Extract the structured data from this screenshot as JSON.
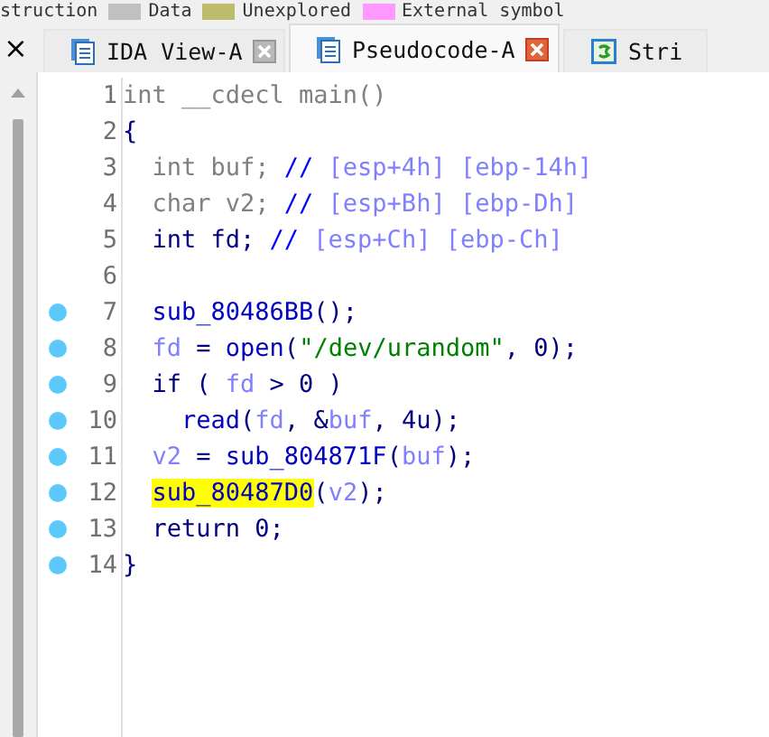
{
  "legend": [
    {
      "label": "struction"
    },
    {
      "label": "Data",
      "color": "#c0c0c0"
    },
    {
      "label": "Unexplored",
      "color": "#bcbc6c"
    },
    {
      "label": "External symbol",
      "color": "#ff99ff"
    }
  ],
  "side_close": "×",
  "tabs": [
    {
      "label": "IDA View-A",
      "selected": false,
      "kind": "view",
      "closable": true
    },
    {
      "label": "Pseudocode-A",
      "selected": true,
      "kind": "view",
      "closable": true
    },
    {
      "label": "Stri",
      "selected": false,
      "kind": "strings",
      "closable": false
    }
  ],
  "code_lines": [
    {
      "number": "1",
      "breakpoint": false,
      "tokens": [
        {
          "text": "int __cdecl main()",
          "kind": "type"
        }
      ]
    },
    {
      "number": "2",
      "breakpoint": false,
      "tokens": [
        {
          "text": "{",
          "kind": "plain"
        }
      ]
    },
    {
      "number": "3",
      "breakpoint": false,
      "tokens": [
        {
          "text": "  int buf; ",
          "kind": "type"
        },
        {
          "text": "// ",
          "kind": "comment"
        },
        {
          "text": "[esp+4h] [ebp-14h]",
          "kind": "var"
        }
      ]
    },
    {
      "number": "4",
      "breakpoint": false,
      "tokens": [
        {
          "text": "  char v2; ",
          "kind": "type"
        },
        {
          "text": "// ",
          "kind": "comment"
        },
        {
          "text": "[esp+Bh] [ebp-Dh]",
          "kind": "var"
        }
      ]
    },
    {
      "number": "5",
      "breakpoint": false,
      "tokens": [
        {
          "text": "  int fd; ",
          "kind": "plain"
        },
        {
          "text": "// ",
          "kind": "comment"
        },
        {
          "text": "[esp+Ch] [ebp-Ch]",
          "kind": "var"
        }
      ]
    },
    {
      "number": "6",
      "breakpoint": false
    },
    {
      "number": "7",
      "breakpoint": true,
      "tokens": [
        {
          "text": "  sub_80486BB",
          "kind": "func"
        },
        {
          "text": "();",
          "kind": "plain"
        }
      ]
    },
    {
      "number": "8",
      "breakpoint": true,
      "tokens": [
        {
          "text": "  fd",
          "kind": "var"
        },
        {
          "text": " = ",
          "kind": "plain"
        },
        {
          "text": "open",
          "kind": "func"
        },
        {
          "text": "(",
          "kind": "plain"
        },
        {
          "text": "\"/dev/urandom\"",
          "kind": "string"
        },
        {
          "text": ", 0);",
          "kind": "plain"
        }
      ]
    },
    {
      "number": "9",
      "breakpoint": true,
      "tokens": [
        {
          "text": "  if ( ",
          "kind": "plain"
        },
        {
          "text": "fd",
          "kind": "var"
        },
        {
          "text": " > 0 )",
          "kind": "plain"
        }
      ]
    },
    {
      "number": "10",
      "breakpoint": true,
      "tokens": [
        {
          "text": "    read",
          "kind": "func"
        },
        {
          "text": "(",
          "kind": "plain"
        },
        {
          "text": "fd",
          "kind": "var"
        },
        {
          "text": ", &",
          "kind": "plain"
        },
        {
          "text": "buf",
          "kind": "var"
        },
        {
          "text": ", 4u);",
          "kind": "plain"
        }
      ]
    },
    {
      "number": "11",
      "breakpoint": true,
      "tokens": [
        {
          "text": "  v2",
          "kind": "var"
        },
        {
          "text": " = ",
          "kind": "plain"
        },
        {
          "text": "sub_804871F",
          "kind": "func"
        },
        {
          "text": "(",
          "kind": "plain"
        },
        {
          "text": "buf",
          "kind": "var"
        },
        {
          "text": ");",
          "kind": "plain"
        }
      ]
    },
    {
      "number": "12",
      "breakpoint": true,
      "tokens": [
        {
          "text": "  sub_80487D0",
          "kind": "highlight"
        },
        {
          "text": "(",
          "kind": "plain"
        },
        {
          "text": "v2",
          "kind": "var"
        },
        {
          "text": ");",
          "kind": "plain"
        }
      ]
    },
    {
      "number": "13",
      "breakpoint": true,
      "tokens": [
        {
          "text": "  return 0;",
          "kind": "plain"
        }
      ]
    },
    {
      "number": "14",
      "breakpoint": true,
      "tokens": [
        {
          "text": "}",
          "kind": "plain"
        }
      ]
    }
  ]
}
